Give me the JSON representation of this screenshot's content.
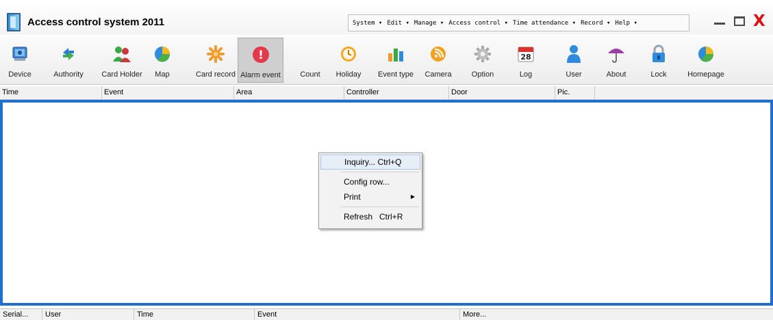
{
  "window": {
    "title": "Access control system 2011",
    "close_glyph": "X"
  },
  "menubar": {
    "items": [
      "System ▾",
      "Edit ▾",
      "Manage ▾",
      "Access control ▾",
      "Time attendance ▾",
      "Record ▾",
      "Help ▾"
    ]
  },
  "toolbar": {
    "buttons": [
      {
        "label": "Device",
        "icon": "device-icon",
        "active": false
      },
      {
        "label": "Authority",
        "icon": "authority-icon",
        "active": false
      },
      {
        "label": "Card Holder",
        "icon": "card-holder-icon",
        "active": false
      },
      {
        "label": "Map",
        "icon": "map-icon",
        "active": false
      },
      {
        "label": "Card record",
        "icon": "card-record-icon",
        "active": false
      },
      {
        "label": "Alarm event",
        "icon": "alarm-icon",
        "active": true
      },
      {
        "label": "Count",
        "icon": "count-icon",
        "active": false
      },
      {
        "label": "Holiday",
        "icon": "clock-icon",
        "active": false
      },
      {
        "label": "Event type",
        "icon": "bar-chart-icon",
        "active": false
      },
      {
        "label": "Camera",
        "icon": "camera-icon",
        "active": false
      },
      {
        "label": "Option",
        "icon": "gear-icon",
        "active": false
      },
      {
        "label": "Log",
        "icon": "calendar-icon",
        "active": false
      },
      {
        "label": "User",
        "icon": "user-icon",
        "active": false
      },
      {
        "label": "About",
        "icon": "umbrella-icon",
        "active": false
      },
      {
        "label": "Lock",
        "icon": "lock-icon",
        "active": false
      },
      {
        "label": "Homepage",
        "icon": "homepage-icon",
        "active": false
      }
    ],
    "calendar_day": "28",
    "alarm_glyph": "!"
  },
  "event_table": {
    "columns": [
      "Time",
      "Event",
      "Area",
      "Controller",
      "Door",
      "Pic."
    ]
  },
  "context_menu": {
    "items": [
      {
        "label": "Inquiry... Ctrl+Q",
        "highlighted": true,
        "submenu": false
      },
      {
        "label": "Config row...",
        "highlighted": false,
        "submenu": false
      },
      {
        "label": "Print",
        "highlighted": false,
        "submenu": true
      },
      {
        "label": "Refresh   Ctrl+R",
        "highlighted": false,
        "submenu": false
      }
    ]
  },
  "bottom_table": {
    "columns": [
      "Serial...",
      "User",
      "Time",
      "Event",
      "More..."
    ]
  },
  "colors": {
    "accent_border": "#1f6fd1",
    "close_red": "#dd1010"
  }
}
